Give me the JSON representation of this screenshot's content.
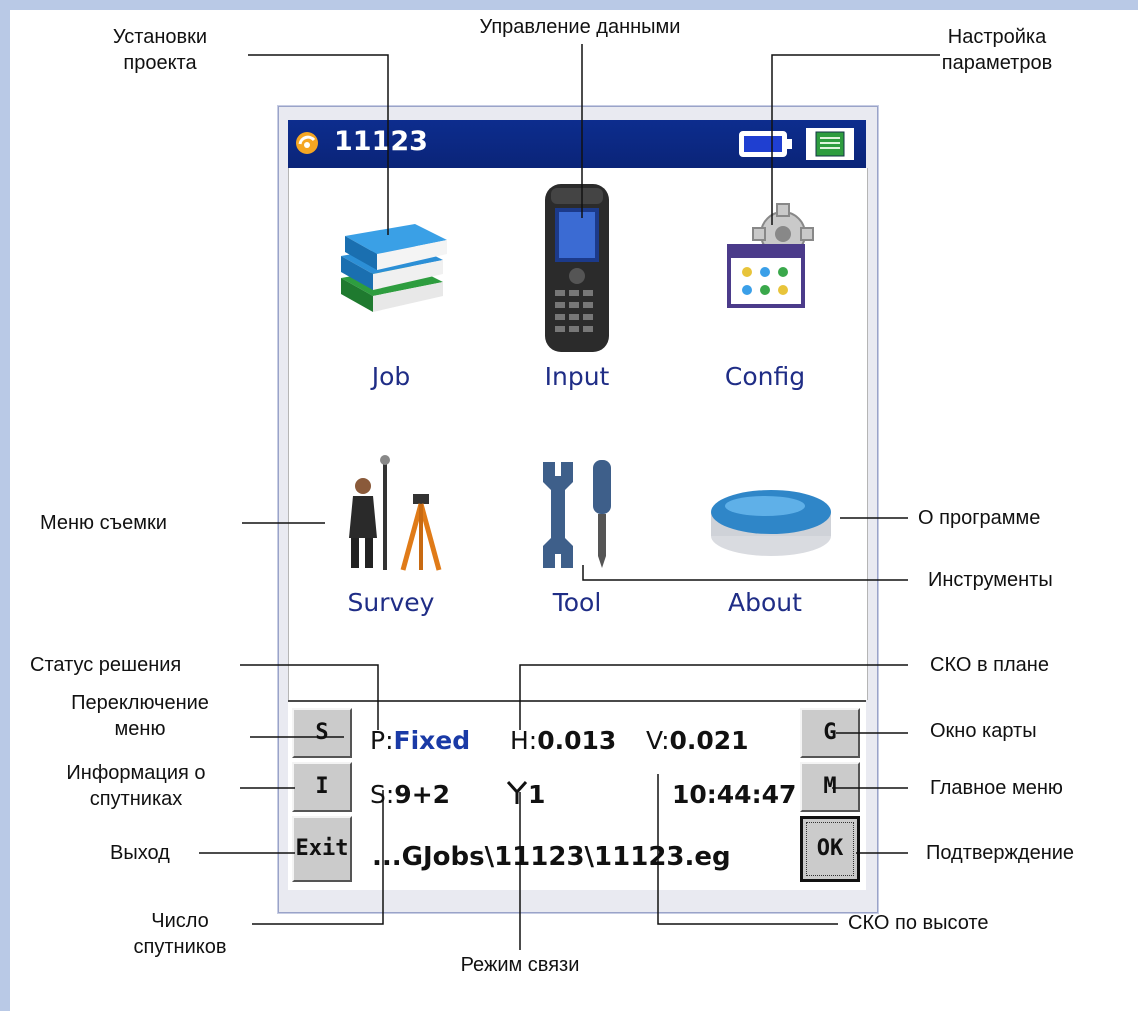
{
  "annotations": {
    "project_settings": "Установки\nпроекта",
    "data_management": "Управление данными",
    "parameter_settings": "Настройка\nпараметров",
    "survey_menu": "Меню съемки",
    "about_program": "О программе",
    "tools": "Инструменты",
    "solution_status": "Статус решения",
    "rms_plan": "СКО в плане",
    "menu_switch": "Переключение\nменю",
    "map_window": "Окно карты",
    "satellite_info": "Информация о\nспутниках",
    "main_menu": "Главное меню",
    "exit": "Выход",
    "confirm": "Подтверждение",
    "num_satellites": "Число\nспутников",
    "rms_height": "СКО по высоте",
    "link_mode": "Режим связи"
  },
  "device": {
    "title": "11123",
    "apps": [
      {
        "label": "Job",
        "icon": "books-icon"
      },
      {
        "label": "Input",
        "icon": "handheld-controller-icon"
      },
      {
        "label": "Config",
        "icon": "gear-settings-icon"
      },
      {
        "label": "Survey",
        "icon": "surveyor-tripod-icon"
      },
      {
        "label": "Tool",
        "icon": "wrench-screwdriver-icon"
      },
      {
        "label": "About",
        "icon": "gnss-receiver-icon"
      }
    ],
    "status": {
      "solution_prefix": "P:",
      "solution_value": "Fixed",
      "h_prefix": "H:",
      "h_value": "0.013",
      "v_prefix": "V:",
      "v_value": "0.021",
      "sat_prefix": "S:",
      "sat_value": "9+2",
      "link_value": "1",
      "time": "10:44:47",
      "path": "...GJobs\\11123\\11123.eg"
    },
    "buttons": {
      "s": "S",
      "i": "I",
      "exit": "Exit",
      "g": "G",
      "m": "M",
      "ok": "OK"
    }
  }
}
